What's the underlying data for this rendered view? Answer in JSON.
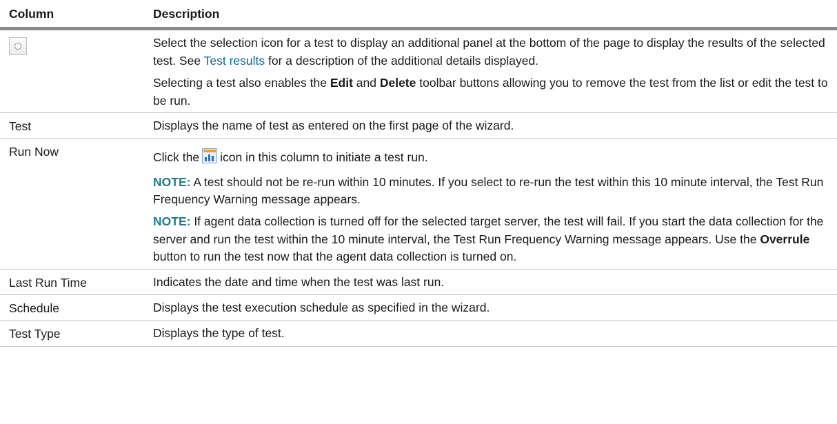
{
  "table": {
    "header": {
      "column": "Column",
      "description": "Description"
    },
    "rows": {
      "select": {
        "name_icon": "selection-radio-icon",
        "p1_a": "Select the selection icon for a test to display an additional panel at the bottom of the page to display the results of the selected test. See ",
        "p1_link": "Test results",
        "p1_b": " for a description of the additional details displayed.",
        "p2_a": "Selecting a test also enables the ",
        "p2_edit": "Edit",
        "p2_and": " and ",
        "p2_delete": "Delete",
        "p2_b": " toolbar buttons allowing you to remove the test from the list or edit the test to be run."
      },
      "test": {
        "name": "Test",
        "desc": "Displays the name of test as entered on the first page of the wizard."
      },
      "run_now": {
        "name": "Run Now",
        "p1_a": "Click the",
        "p1_icon": "run-report-icon",
        "p1_b": "icon in this column to initiate a test run.",
        "note_label": "NOTE:",
        "note1": " A test should not be re-run within 10 minutes. If you select to re-run the test within this 10 minute interval, the Test Run Frequency Warning message appears.",
        "note2_a": " If agent data collection is turned off for the selected target server, the test will fail. If you start the data collection for the server and run the test within the 10 minute interval, the Test Run Frequency Warning message appears. Use the ",
        "note2_overrule": "Overrule",
        "note2_b": " button to run the test now that the agent data collection is turned on."
      },
      "last_run": {
        "name": "Last Run Time",
        "desc": "Indicates the date and time when the test was last run."
      },
      "schedule": {
        "name": "Schedule",
        "desc": "Displays the test execution schedule as specified in the wizard."
      },
      "test_type": {
        "name": "Test Type",
        "desc": "Displays the type of test."
      }
    }
  },
  "colors": {
    "link": "#0a6aa1",
    "note": "#227a89",
    "header_rule": "#8a8a8a"
  }
}
